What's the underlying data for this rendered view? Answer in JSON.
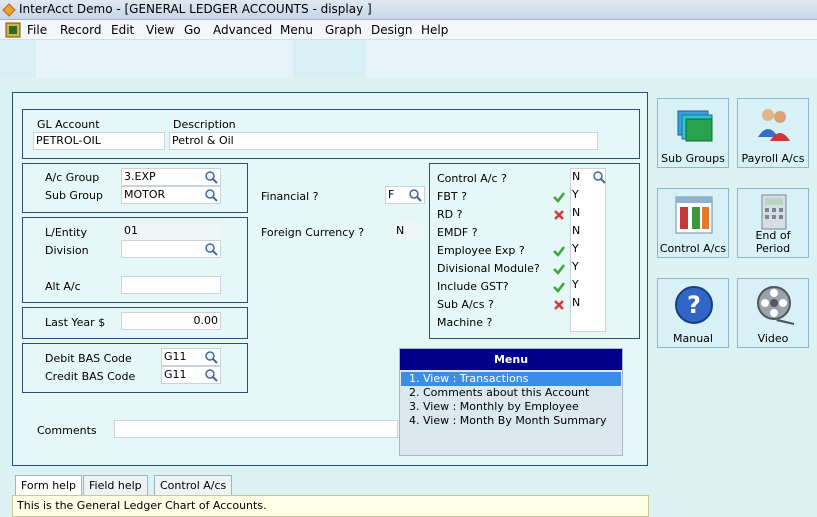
{
  "window": {
    "title": "InterAcct Demo - [GENERAL LEDGER ACCOUNTS - display ]"
  },
  "menubar": {
    "items": [
      "File",
      "Record",
      "Edit",
      "View",
      "Go",
      "Advanced",
      "Menu",
      "Graph",
      "Design",
      "Help"
    ]
  },
  "account": {
    "gl_account_label": "GL Account",
    "description_label": "Description",
    "gl_account_value": "PETROL-OIL",
    "description_value": "Petrol & Oil"
  },
  "group": {
    "ac_group_label": "A/c Group",
    "ac_group_value": "3.EXP",
    "sub_group_label": "Sub Group",
    "sub_group_value": "MOTOR"
  },
  "entity": {
    "lentity_label": "L/Entity",
    "lentity_value": "01",
    "division_label": "Division",
    "division_value": "",
    "alt_ac_label": "Alt A/c",
    "alt_ac_value": ""
  },
  "amounts": {
    "last_year_label": "Last Year $",
    "last_year_value": "0.00"
  },
  "bas": {
    "debit_label": "Debit  BAS Code",
    "debit_value": "G11",
    "credit_label": "Credit BAS Code",
    "credit_value": "G11"
  },
  "financial": {
    "financial_label": "Financial ?",
    "financial_value": "F",
    "foreign_label": "Foreign Currency ?",
    "foreign_value": "N"
  },
  "flags": [
    {
      "label": "Control A/c ?",
      "value": "N",
      "mark": "none"
    },
    {
      "label": "FBT ?",
      "value": "Y",
      "mark": "tick"
    },
    {
      "label": "RD ?",
      "value": "N",
      "mark": "cross"
    },
    {
      "label": "EMDF ?",
      "value": "N",
      "mark": "none"
    },
    {
      "label": "Employee Exp ?",
      "value": "Y",
      "mark": "tick"
    },
    {
      "label": "Divisional Module?",
      "value": "Y",
      "mark": "tick"
    },
    {
      "label": "Include GST?",
      "value": "Y",
      "mark": "tick"
    },
    {
      "label": "Sub A/cs ?",
      "value": "N",
      "mark": "cross"
    },
    {
      "label": "Machine ?",
      "value": "",
      "mark": "none"
    }
  ],
  "comments": {
    "label": "Comments",
    "value": ""
  },
  "menu_panel": {
    "title": "Menu",
    "items": [
      "1. View : Transactions",
      "2. Comments about this Account",
      "3. View : Monthly by Employee",
      "4. View : Month By Month Summary"
    ]
  },
  "side_buttons": [
    {
      "label": "Sub Groups",
      "icon": "folders-icon"
    },
    {
      "label": "Payroll A/cs",
      "icon": "people-icon"
    },
    {
      "label": "Control A/cs",
      "icon": "spreadsheet-icon"
    },
    {
      "label": "End of\nPeriod",
      "icon": "calculator-icon"
    },
    {
      "label": "Manual",
      "icon": "help-icon"
    },
    {
      "label": "Video",
      "icon": "film-reel-icon"
    }
  ],
  "help_tabs": [
    "Form help",
    "Field help",
    "Control A/cs"
  ],
  "help_text": "This is the General Ledger Chart of Accounts.",
  "colors": {
    "panel_border": "#2c4f7a",
    "menu_header": "#00008a",
    "menu_selected": "#3b8ee8",
    "help_bg": "#ffffe6"
  }
}
